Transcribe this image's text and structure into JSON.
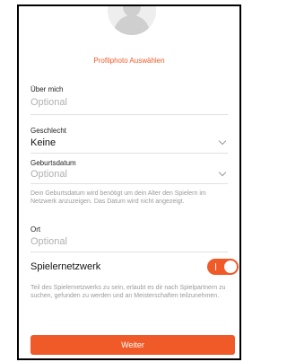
{
  "profile": {
    "photo_link": "Profilphoto Auswählen"
  },
  "about": {
    "label": "Über mich",
    "placeholder": "Optional"
  },
  "gender": {
    "label": "Geschlecht",
    "value": "Keine"
  },
  "birthdate": {
    "label": "Geburtsdatum",
    "value": "Optional",
    "help": "Dein Geburtsdatum wird benötigt um dein Alter den Spielern im Netzwerk anzuzeigen. Das Datum wird nicht angezeigt."
  },
  "location": {
    "label": "Ort",
    "placeholder": "Optional"
  },
  "player_network": {
    "title": "Spielernetzwerk",
    "enabled": true,
    "help": "Teil des Spielernetzwerks zu sein, erlaubt es dir nach Spielpartnern zu suchen, gefunden zu werden und an Meisterschaften teilzunehmen."
  },
  "actions": {
    "next_label": "Weiter"
  },
  "colors": {
    "accent": "#f05a28",
    "placeholder": "#b0b0b0",
    "help_text": "#9a9a9a"
  }
}
